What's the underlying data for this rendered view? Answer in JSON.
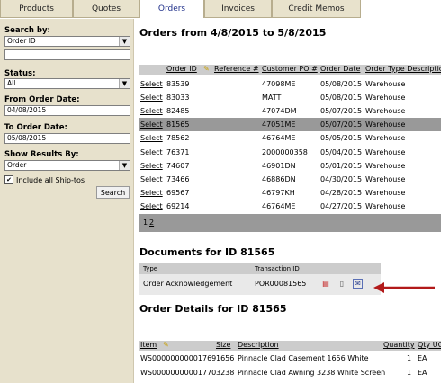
{
  "tabs": [
    {
      "label": "Products",
      "active": false
    },
    {
      "label": "Quotes",
      "active": false
    },
    {
      "label": "Orders",
      "active": true
    },
    {
      "label": "Invoices",
      "active": false
    },
    {
      "label": "Credit Memos",
      "active": false
    }
  ],
  "sidebar": {
    "search_by_label": "Search by:",
    "search_by_value": "Order ID",
    "search_text_value": "",
    "status_label": "Status:",
    "status_value": "All",
    "from_label": "From Order Date:",
    "from_value": "04/08/2015",
    "to_label": "To Order Date:",
    "to_value": "05/08/2015",
    "show_label": "Show Results By:",
    "show_value": "Order",
    "include_label": "Include all Ship-tos",
    "include_checked": true,
    "search_button": "Search"
  },
  "orders": {
    "title": "Orders from 4/8/2015 to 5/8/2015",
    "columns": [
      "Order ID",
      "Reference #",
      "Customer PO #",
      "Order Date",
      "Order Type Description"
    ],
    "select_label": "Select",
    "rows": [
      {
        "id": "83539",
        "ref": "",
        "po": "47098ME",
        "date": "05/08/2015",
        "type": "Warehouse",
        "selected": false
      },
      {
        "id": "83033",
        "ref": "",
        "po": "MATT",
        "date": "05/08/2015",
        "type": "Warehouse",
        "selected": false
      },
      {
        "id": "82485",
        "ref": "",
        "po": "47074DM",
        "date": "05/07/2015",
        "type": "Warehouse",
        "selected": false
      },
      {
        "id": "81565",
        "ref": "",
        "po": "47051ME",
        "date": "05/07/2015",
        "type": "Warehouse",
        "selected": true
      },
      {
        "id": "78562",
        "ref": "",
        "po": "46764ME",
        "date": "05/05/2015",
        "type": "Warehouse",
        "selected": false
      },
      {
        "id": "76371",
        "ref": "",
        "po": "2000000358",
        "date": "05/04/2015",
        "type": "Warehouse",
        "selected": false
      },
      {
        "id": "74607",
        "ref": "",
        "po": "46901DN",
        "date": "05/01/2015",
        "type": "Warehouse",
        "selected": false
      },
      {
        "id": "73466",
        "ref": "",
        "po": "46886DN",
        "date": "04/30/2015",
        "type": "Warehouse",
        "selected": false
      },
      {
        "id": "69567",
        "ref": "",
        "po": "46797KH",
        "date": "04/28/2015",
        "type": "Warehouse",
        "selected": false
      },
      {
        "id": "69214",
        "ref": "",
        "po": "46764ME",
        "date": "04/27/2015",
        "type": "Warehouse",
        "selected": false
      }
    ],
    "pages": [
      "1",
      "2"
    ]
  },
  "documents": {
    "title": "Documents for ID 81565",
    "col_type": "Type",
    "col_txn": "Transaction ID",
    "row_type": "Order Acknowledgement",
    "row_txn": "POR00081565",
    "icons": [
      "pdf-icon",
      "document-icon",
      "email-icon"
    ]
  },
  "details": {
    "title": "Order Details for ID 81565",
    "columns": [
      "Item",
      "Size",
      "Description",
      "Quantity",
      "Qty UOM"
    ],
    "rows": [
      {
        "item": "WS00000000001769",
        "size": "1656",
        "desc": "Pinnacle Clad Casement 1656 White",
        "qty": "1",
        "uom": "EA"
      },
      {
        "item": "WS00000000001770",
        "size": "3238",
        "desc": "Pinnacle Clad Awning 3238 White Screen",
        "qty": "1",
        "uom": "EA"
      }
    ]
  },
  "colors": {
    "tab_bg": "#e8e2cc",
    "sidebar_bg": "#e7e1cc",
    "selected_row": "#999999",
    "header_bg": "#cccccc",
    "active_tab_text": "#1f2f8a",
    "arrow": "#b21a1a"
  }
}
